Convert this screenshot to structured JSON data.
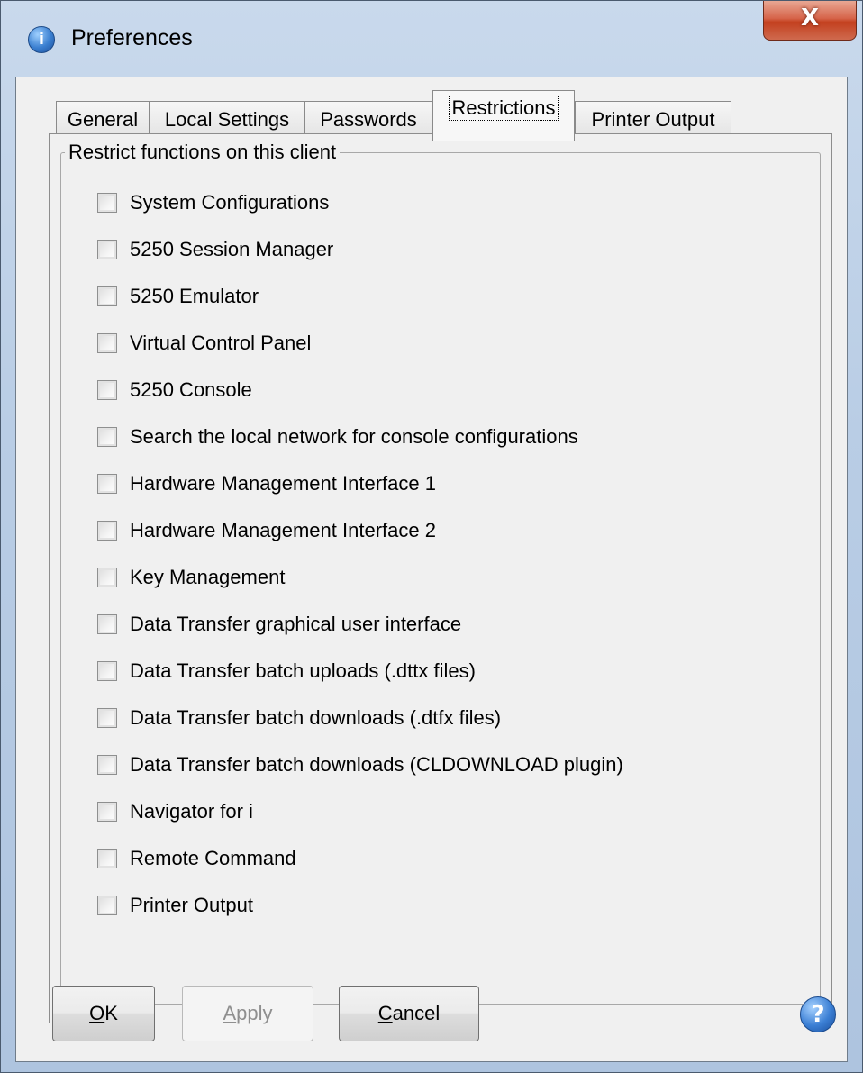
{
  "window": {
    "title": "Preferences",
    "title_icon": "info-icon",
    "close_icon": "close-icon",
    "close_glyph": "X"
  },
  "tabs": [
    {
      "label": "General"
    },
    {
      "label": "Local Settings"
    },
    {
      "label": "Passwords"
    },
    {
      "label": "Restrictions",
      "selected": true
    },
    {
      "label": "Printer Output"
    }
  ],
  "group": {
    "legend": "Restrict functions on this client",
    "items": [
      {
        "label": "System Configurations",
        "checked": false
      },
      {
        "label": "5250 Session Manager",
        "checked": false
      },
      {
        "label": "5250 Emulator",
        "checked": false
      },
      {
        "label": "Virtual Control Panel",
        "checked": false
      },
      {
        "label": "5250 Console",
        "checked": false
      },
      {
        "label": "Search the local network for console configurations",
        "checked": false
      },
      {
        "label": "Hardware Management Interface 1",
        "checked": false
      },
      {
        "label": "Hardware Management Interface 2",
        "checked": false
      },
      {
        "label": "Key Management",
        "checked": false
      },
      {
        "label": "Data Transfer graphical user interface",
        "checked": false
      },
      {
        "label": "Data Transfer batch uploads (.dttx files)",
        "checked": false
      },
      {
        "label": "Data Transfer batch downloads (.dtfx files)",
        "checked": false
      },
      {
        "label": "Data Transfer batch downloads (CLDOWNLOAD plugin)",
        "checked": false
      },
      {
        "label": "Navigator for i",
        "checked": false
      },
      {
        "label": "Remote Command",
        "checked": false
      },
      {
        "label": "Printer Output",
        "checked": false
      }
    ]
  },
  "buttons": {
    "ok": {
      "mnemonic": "O",
      "rest": "K"
    },
    "apply": {
      "mnemonic": "A",
      "rest": "pply",
      "enabled": false
    },
    "cancel": {
      "mnemonic": "C",
      "rest": "ancel"
    },
    "help_icon": "help-icon",
    "help_glyph": "?"
  }
}
